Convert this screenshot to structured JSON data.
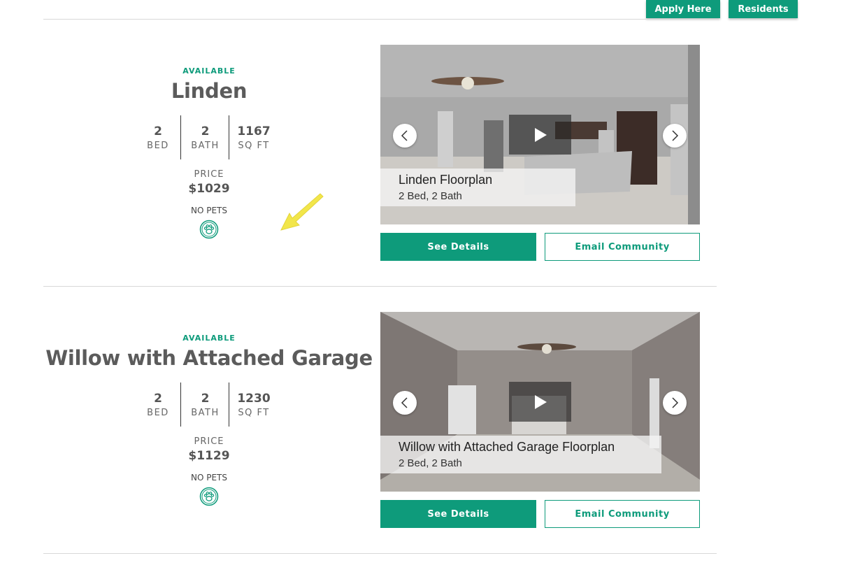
{
  "header": {
    "apply_label": "Apply Here",
    "residents_label": "Residents"
  },
  "colors": {
    "accent": "#0e9b7b",
    "highlight_arrow": "#f2e64a"
  },
  "listings": [
    {
      "status": "AVAILABLE",
      "name": "Linden",
      "bed": "2",
      "bed_label": "BED",
      "bath": "2",
      "bath_label": "BATH",
      "sqft": "1167",
      "sqft_label": "SQ FT",
      "price_label": "PRICE",
      "price": "$1029",
      "pets": "NO PETS",
      "pet_icon": "paw-icon",
      "caption_title": "Linden Floorplan",
      "caption_sub": "2 Bed, 2 Bath",
      "details_label": "See Details",
      "email_label": "Email Community"
    },
    {
      "status": "AVAILABLE",
      "name": "Willow with Attached Garage",
      "bed": "2",
      "bed_label": "BED",
      "bath": "2",
      "bath_label": "BATH",
      "sqft": "1230",
      "sqft_label": "SQ FT",
      "price_label": "PRICE",
      "price": "$1129",
      "pets": "NO PETS",
      "pet_icon": "paw-icon",
      "caption_title": "Willow with Attached Garage Floorplan",
      "caption_sub": "2 Bed, 2 Bath",
      "details_label": "See Details",
      "email_label": "Email Community"
    }
  ]
}
